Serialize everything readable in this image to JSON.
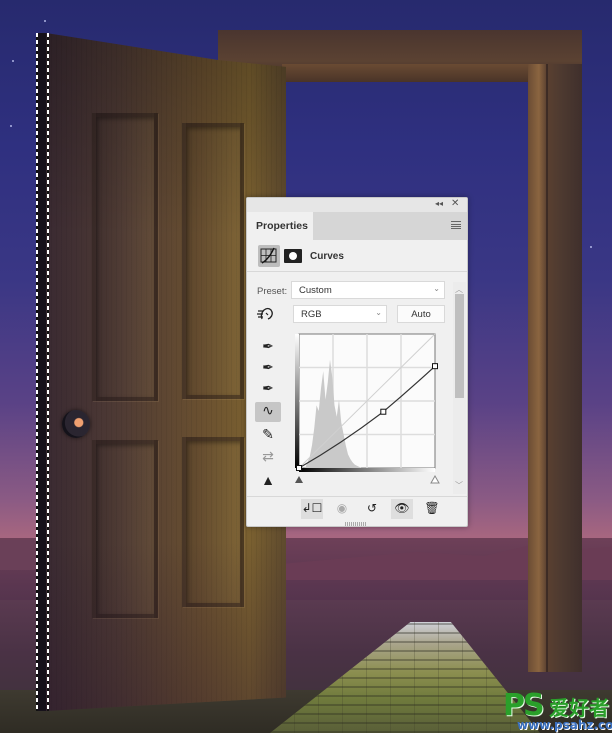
{
  "panel": {
    "tab_label": "Properties",
    "collapse_glyph": "◂◂",
    "close_glyph": "✕",
    "adjustment_title": "Curves",
    "preset_label": "Preset:",
    "preset_value": "Custom",
    "channel_value": "RGB",
    "auto_label": "Auto",
    "scroll_up_glyph": "︿",
    "scroll_down_glyph": "﹀",
    "chevron_glyph": "⌄"
  },
  "tools": [
    {
      "name": "sample-black-point-icon",
      "glyph": "✒",
      "active": false,
      "dim": false
    },
    {
      "name": "sample-gray-point-icon",
      "glyph": "✒",
      "active": false,
      "dim": false
    },
    {
      "name": "sample-white-point-icon",
      "glyph": "✒",
      "active": false,
      "dim": false
    },
    {
      "name": "curve-points-icon",
      "glyph": "∿",
      "active": true,
      "dim": false
    },
    {
      "name": "pencil-icon",
      "glyph": "✎",
      "active": false,
      "dim": false
    },
    {
      "name": "smooth-curve-icon",
      "glyph": "⇄",
      "active": false,
      "dim": true
    },
    {
      "name": "clipping-warning-icon",
      "glyph": "▲",
      "active": false,
      "dim": false
    }
  ],
  "curve": {
    "channel": "RGB",
    "points": [
      [
        0,
        0
      ],
      [
        0.62,
        0.42
      ],
      [
        1.0,
        0.76
      ]
    ],
    "input_range": [
      0,
      255
    ],
    "output_range": [
      0,
      255
    ]
  },
  "bottom_buttons": [
    {
      "name": "clip-to-layer-icon",
      "glyph": "↲☐",
      "shade": true,
      "dim": false
    },
    {
      "name": "view-previous-state-icon",
      "glyph": "◉",
      "shade": false,
      "dim": true
    },
    {
      "name": "reset-icon",
      "glyph": "↺",
      "shade": false,
      "dim": false
    },
    {
      "name": "visibility-eye-icon",
      "glyph": "👁",
      "shade": true,
      "dim": false
    },
    {
      "name": "delete-icon",
      "glyph": "🗑",
      "shade": false,
      "dim": false
    }
  ],
  "watermark": {
    "brand": "PS",
    "chinese": "爱好者",
    "url": "www.psahz.com"
  }
}
